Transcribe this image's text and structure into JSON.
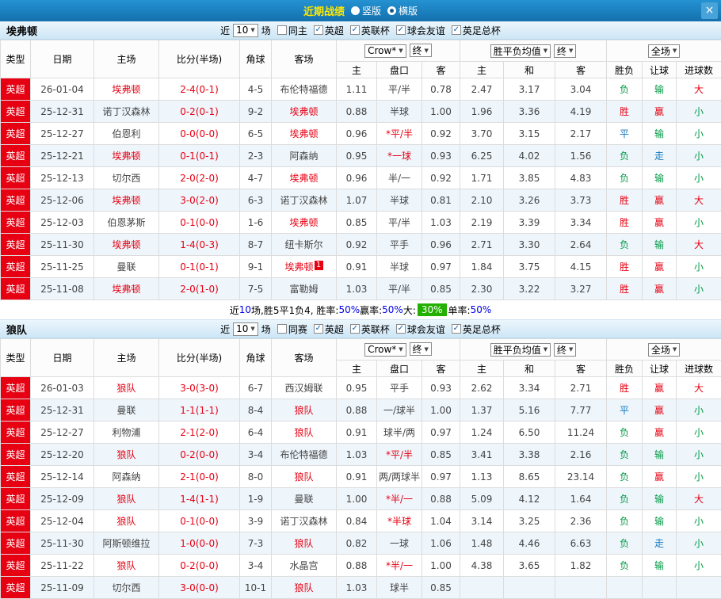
{
  "topbar": {
    "title": "近期战绩",
    "vertical_label": "竖版",
    "horizontal_label": "横版",
    "selected_layout": "横版",
    "close_glyph": "×"
  },
  "labels": {
    "near": "近",
    "games": "场"
  },
  "table_header": {
    "type": "类型",
    "date": "日期",
    "home": "主场",
    "score": "比分(半场)",
    "corner": "角球",
    "away": "客场",
    "bookmaker": "Crow*",
    "final": "终",
    "avg": "胜平负均值",
    "fulltime": "全场",
    "odds_home": "主",
    "handicap": "盘口",
    "odds_away": "客",
    "avg_home": "主",
    "avg_draw": "和",
    "avg_away": "客",
    "wdl": "胜负",
    "asian": "让球",
    "goals": "进球数"
  },
  "colors": {
    "accent_blue": "#1470ad",
    "league_red": "#e60012",
    "win_red": "#e60012",
    "lose_green": "#009944",
    "draw_blue": "#1577be",
    "badge_green": "#23b000"
  },
  "sections": [
    {
      "team": "埃弗顿",
      "count": "10",
      "filters": [
        {
          "label": "同主",
          "checked": false
        },
        {
          "label": "英超",
          "checked": true
        },
        {
          "label": "英联杯",
          "checked": true
        },
        {
          "label": "球会友谊",
          "checked": true
        },
        {
          "label": "英足总杯",
          "checked": true
        }
      ],
      "rows": [
        {
          "league": "英超",
          "date": "26-01-04",
          "home": "埃弗顿",
          "home_red": true,
          "score": "2-4(0-1)",
          "corner": "4-5",
          "away": "布伦特福德",
          "o1": "1.11",
          "hcp": "平/半",
          "o2": "0.78",
          "a1": "2.47",
          "a2": "3.17",
          "a3": "3.04",
          "r1": "负",
          "c1": "g",
          "r2": "输",
          "c2": "g",
          "r3": "大",
          "c3": "r"
        },
        {
          "league": "英超",
          "date": "25-12-31",
          "home": "诺丁汉森林",
          "score": "0-2(0-1)",
          "corner": "9-2",
          "away": "埃弗顿",
          "away_red": true,
          "o1": "0.88",
          "hcp": "半球",
          "o2": "1.00",
          "a1": "1.96",
          "a2": "3.36",
          "a3": "4.19",
          "r1": "胜",
          "c1": "r",
          "r2": "赢",
          "c2": "r",
          "r3": "小",
          "c3": "g"
        },
        {
          "league": "英超",
          "date": "25-12-27",
          "home": "伯恩利",
          "score": "0-0(0-0)",
          "corner": "6-5",
          "away": "埃弗顿",
          "away_red": true,
          "o1": "0.96",
          "hcp": "*平/半",
          "hcp_red": true,
          "o2": "0.92",
          "a1": "3.70",
          "a2": "3.15",
          "a3": "2.17",
          "r1": "平",
          "c1": "b",
          "r2": "输",
          "c2": "g",
          "r3": "小",
          "c3": "g"
        },
        {
          "league": "英超",
          "date": "25-12-21",
          "home": "埃弗顿",
          "home_red": true,
          "score": "0-1(0-1)",
          "corner": "2-3",
          "away": "阿森纳",
          "o1": "0.95",
          "hcp": "*一球",
          "hcp_red": true,
          "o2": "0.93",
          "a1": "6.25",
          "a2": "4.02",
          "a3": "1.56",
          "r1": "负",
          "c1": "g",
          "r2": "走",
          "c2": "b",
          "r3": "小",
          "c3": "g"
        },
        {
          "league": "英超",
          "date": "25-12-13",
          "home": "切尔西",
          "score": "2-0(2-0)",
          "corner": "4-7",
          "away": "埃弗顿",
          "away_red": true,
          "o1": "0.96",
          "hcp": "半/一",
          "o2": "0.92",
          "a1": "1.71",
          "a2": "3.85",
          "a3": "4.83",
          "r1": "负",
          "c1": "g",
          "r2": "输",
          "c2": "g",
          "r3": "小",
          "c3": "g"
        },
        {
          "league": "英超",
          "date": "25-12-06",
          "home": "埃弗顿",
          "home_red": true,
          "score": "3-0(2-0)",
          "corner": "6-3",
          "away": "诺丁汉森林",
          "o1": "1.07",
          "hcp": "半球",
          "o2": "0.81",
          "a1": "2.10",
          "a2": "3.26",
          "a3": "3.73",
          "r1": "胜",
          "c1": "r",
          "r2": "赢",
          "c2": "r",
          "r3": "大",
          "c3": "r"
        },
        {
          "league": "英超",
          "date": "25-12-03",
          "home": "伯恩茅斯",
          "score": "0-1(0-0)",
          "corner": "1-6",
          "away": "埃弗顿",
          "away_red": true,
          "o1": "0.85",
          "hcp": "平/半",
          "o2": "1.03",
          "a1": "2.19",
          "a2": "3.39",
          "a3": "3.34",
          "r1": "胜",
          "c1": "r",
          "r2": "赢",
          "c2": "r",
          "r3": "小",
          "c3": "g"
        },
        {
          "league": "英超",
          "date": "25-11-30",
          "home": "埃弗顿",
          "home_red": true,
          "score": "1-4(0-3)",
          "corner": "8-7",
          "away": "纽卡斯尔",
          "o1": "0.92",
          "hcp": "平手",
          "o2": "0.96",
          "a1": "2.71",
          "a2": "3.30",
          "a3": "2.64",
          "r1": "负",
          "c1": "g",
          "r2": "输",
          "c2": "g",
          "r3": "大",
          "c3": "r"
        },
        {
          "league": "英超",
          "date": "25-11-25",
          "home": "曼联",
          "score": "0-1(0-1)",
          "corner": "9-1",
          "away": "埃弗顿",
          "away_red": true,
          "badge": "1",
          "o1": "0.91",
          "hcp": "半球",
          "o2": "0.97",
          "a1": "1.84",
          "a2": "3.75",
          "a3": "4.15",
          "r1": "胜",
          "c1": "r",
          "r2": "赢",
          "c2": "r",
          "r3": "小",
          "c3": "g"
        },
        {
          "league": "英超",
          "date": "25-11-08",
          "home": "埃弗顿",
          "home_red": true,
          "score": "2-0(1-0)",
          "corner": "7-5",
          "away": "富勒姆",
          "o1": "1.03",
          "hcp": "平/半",
          "o2": "0.85",
          "a1": "2.30",
          "a2": "3.22",
          "a3": "3.27",
          "r1": "胜",
          "c1": "r",
          "r2": "赢",
          "c2": "r",
          "r3": "小",
          "c3": "g"
        }
      ],
      "summary": [
        {
          "t": "近",
          "c": "k"
        },
        {
          "t": "10",
          "c": "b"
        },
        {
          "t": "场,胜5平1负4, 胜率:",
          "c": "k"
        },
        {
          "t": "50%",
          "c": "b"
        },
        {
          "t": " 赢率:",
          "c": "k"
        },
        {
          "t": "50%",
          "c": "b"
        },
        {
          "t": " 大: ",
          "c": "k"
        },
        {
          "t": "30%",
          "c": "badge"
        },
        {
          "t": " 单率:",
          "c": "k"
        },
        {
          "t": "50%",
          "c": "b"
        }
      ]
    },
    {
      "team": "狼队",
      "count": "10",
      "filters": [
        {
          "label": "同赛",
          "checked": false
        },
        {
          "label": "英超",
          "checked": true
        },
        {
          "label": "英联杯",
          "checked": true
        },
        {
          "label": "球会友谊",
          "checked": true
        },
        {
          "label": "英足总杯",
          "checked": true
        }
      ],
      "rows": [
        {
          "league": "英超",
          "date": "26-01-03",
          "home": "狼队",
          "home_red": true,
          "score": "3-0(3-0)",
          "corner": "6-7",
          "away": "西汉姆联",
          "o1": "0.95",
          "hcp": "平手",
          "o2": "0.93",
          "a1": "2.62",
          "a2": "3.34",
          "a3": "2.71",
          "r1": "胜",
          "c1": "r",
          "r2": "赢",
          "c2": "r",
          "r3": "大",
          "c3": "r"
        },
        {
          "league": "英超",
          "date": "25-12-31",
          "home": "曼联",
          "score": "1-1(1-1)",
          "corner": "8-4",
          "away": "狼队",
          "away_red": true,
          "o1": "0.88",
          "hcp": "一/球半",
          "o2": "1.00",
          "a1": "1.37",
          "a2": "5.16",
          "a3": "7.77",
          "r1": "平",
          "c1": "b",
          "r2": "赢",
          "c2": "r",
          "r3": "小",
          "c3": "g"
        },
        {
          "league": "英超",
          "date": "25-12-27",
          "home": "利物浦",
          "score": "2-1(2-0)",
          "corner": "6-4",
          "away": "狼队",
          "away_red": true,
          "o1": "0.91",
          "hcp": "球半/两",
          "o2": "0.97",
          "a1": "1.24",
          "a2": "6.50",
          "a3": "11.24",
          "r1": "负",
          "c1": "g",
          "r2": "赢",
          "c2": "r",
          "r3": "小",
          "c3": "g"
        },
        {
          "league": "英超",
          "date": "25-12-20",
          "home": "狼队",
          "home_red": true,
          "score": "0-2(0-0)",
          "corner": "3-4",
          "away": "布伦特福德",
          "o1": "1.03",
          "hcp": "*平/半",
          "hcp_red": true,
          "o2": "0.85",
          "a1": "3.41",
          "a2": "3.38",
          "a3": "2.16",
          "r1": "负",
          "c1": "g",
          "r2": "输",
          "c2": "g",
          "r3": "小",
          "c3": "g"
        },
        {
          "league": "英超",
          "date": "25-12-14",
          "home": "阿森纳",
          "score": "2-1(0-0)",
          "corner": "8-0",
          "away": "狼队",
          "away_red": true,
          "o1": "0.91",
          "hcp": "两/两球半",
          "o2": "0.97",
          "a1": "1.13",
          "a2": "8.65",
          "a3": "23.14",
          "r1": "负",
          "c1": "g",
          "r2": "赢",
          "c2": "r",
          "r3": "小",
          "c3": "g"
        },
        {
          "league": "英超",
          "date": "25-12-09",
          "home": "狼队",
          "home_red": true,
          "score": "1-4(1-1)",
          "corner": "1-9",
          "away": "曼联",
          "o1": "1.00",
          "hcp": "*半/一",
          "hcp_red": true,
          "o2": "0.88",
          "a1": "5.09",
          "a2": "4.12",
          "a3": "1.64",
          "r1": "负",
          "c1": "g",
          "r2": "输",
          "c2": "g",
          "r3": "大",
          "c3": "r"
        },
        {
          "league": "英超",
          "date": "25-12-04",
          "home": "狼队",
          "home_red": true,
          "score": "0-1(0-0)",
          "corner": "3-9",
          "away": "诺丁汉森林",
          "o1": "0.84",
          "hcp": "*半球",
          "hcp_red": true,
          "o2": "1.04",
          "a1": "3.14",
          "a2": "3.25",
          "a3": "2.36",
          "r1": "负",
          "c1": "g",
          "r2": "输",
          "c2": "g",
          "r3": "小",
          "c3": "g"
        },
        {
          "league": "英超",
          "date": "25-11-30",
          "home": "阿斯顿维拉",
          "score": "1-0(0-0)",
          "corner": "7-3",
          "away": "狼队",
          "away_red": true,
          "o1": "0.82",
          "hcp": "一球",
          "o2": "1.06",
          "a1": "1.48",
          "a2": "4.46",
          "a3": "6.63",
          "r1": "负",
          "c1": "g",
          "r2": "走",
          "c2": "b",
          "r3": "小",
          "c3": "g"
        },
        {
          "league": "英超",
          "date": "25-11-22",
          "home": "狼队",
          "home_red": true,
          "score": "0-2(0-0)",
          "corner": "3-4",
          "away": "水晶宫",
          "o1": "0.88",
          "hcp": "*半/一",
          "hcp_red": true,
          "o2": "1.00",
          "a1": "4.38",
          "a2": "3.65",
          "a3": "1.82",
          "r1": "负",
          "c1": "g",
          "r2": "输",
          "c2": "g",
          "r3": "小",
          "c3": "g"
        },
        {
          "league": "英超",
          "date": "25-11-09",
          "home": "切尔西",
          "score": "3-0(0-0)",
          "corner": "10-1",
          "away": "狼队",
          "away_red": true,
          "o1": "1.03",
          "hcp": "球半",
          "o2": "0.85",
          "a1": "",
          "a2": "",
          "a3": "",
          "r1": "",
          "c1": "",
          "r2": "",
          "c2": "",
          "r3": "",
          "c3": ""
        }
      ]
    }
  ]
}
